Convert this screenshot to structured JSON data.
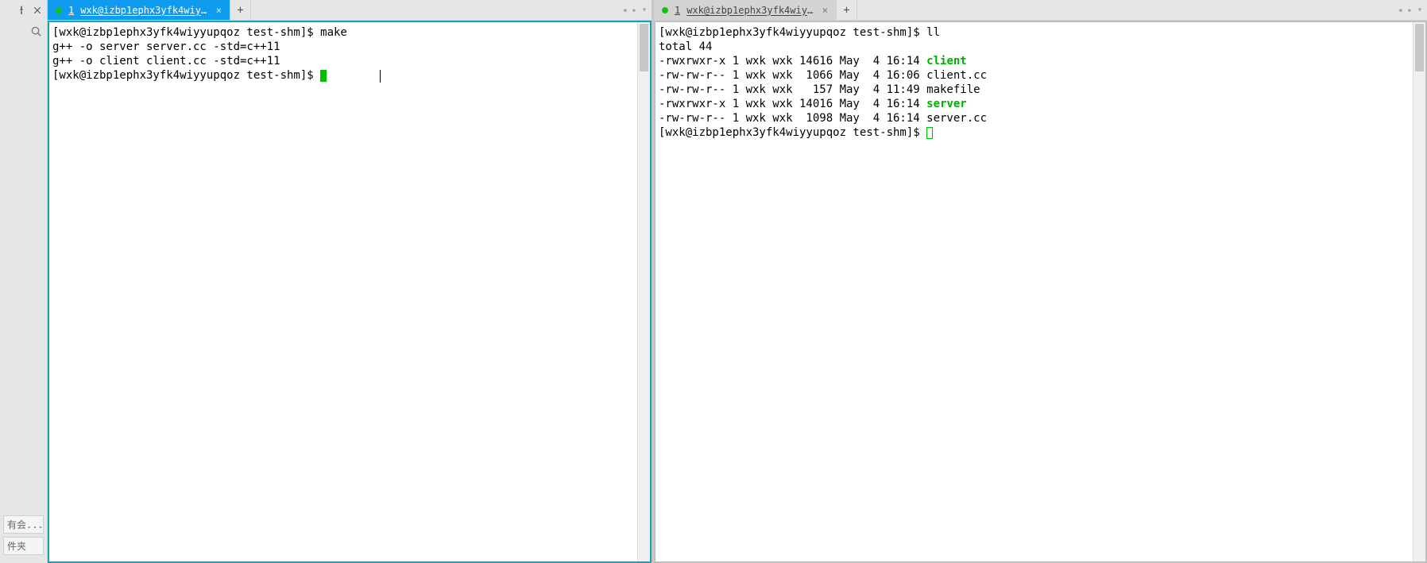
{
  "sidebar": {
    "bottom_chips": [
      "有会...",
      "件夹"
    ]
  },
  "panes": {
    "left": {
      "tab": {
        "num": "1",
        "label": "wxk@izbp1ephx3yfk4wiyy..."
      },
      "lines": [
        {
          "segments": [
            {
              "t": "[wxk@izbp1ephx3yfk4wiyyupqoz test-shm]$ make"
            }
          ]
        },
        {
          "segments": [
            {
              "t": "g++ -o server server.cc -std=c++11"
            }
          ]
        },
        {
          "segments": [
            {
              "t": "g++ -o client client.cc -std=c++11"
            }
          ]
        },
        {
          "segments": [
            {
              "t": "[wxk@izbp1ephx3yfk4wiyyupqoz test-shm]$ "
            },
            {
              "cursor": "block"
            }
          ]
        }
      ]
    },
    "right": {
      "tab": {
        "num": "1",
        "label": "wxk@izbp1ephx3yfk4wiyyup..."
      },
      "lines": [
        {
          "segments": [
            {
              "t": "[wxk@izbp1ephx3yfk4wiyyupqoz test-shm]$ ll"
            }
          ]
        },
        {
          "segments": [
            {
              "t": "total 44"
            }
          ]
        },
        {
          "segments": [
            {
              "t": "-rwxrwxr-x 1 wxk wxk 14616 May  4 16:14 "
            },
            {
              "t": "client",
              "cls": "hl-green"
            }
          ]
        },
        {
          "segments": [
            {
              "t": "-rw-rw-r-- 1 wxk wxk  1066 May  4 16:06 client.cc"
            }
          ]
        },
        {
          "segments": [
            {
              "t": "-rw-rw-r-- 1 wxk wxk   157 May  4 11:49 makefile"
            }
          ]
        },
        {
          "segments": [
            {
              "t": "-rwxrwxr-x 1 wxk wxk 14016 May  4 16:14 "
            },
            {
              "t": "server",
              "cls": "hl-green"
            }
          ]
        },
        {
          "segments": [
            {
              "t": "-rw-rw-r-- 1 wxk wxk  1098 May  4 16:14 server.cc"
            }
          ]
        },
        {
          "segments": [
            {
              "t": "[wxk@izbp1ephx3yfk4wiyyupqoz test-shm]$ "
            },
            {
              "cursor": "outline"
            }
          ]
        }
      ]
    }
  },
  "glyphs": {
    "close": "×",
    "plus": "+",
    "arrow_left": "◂",
    "arrow_right": "▸",
    "drop": "▾"
  }
}
